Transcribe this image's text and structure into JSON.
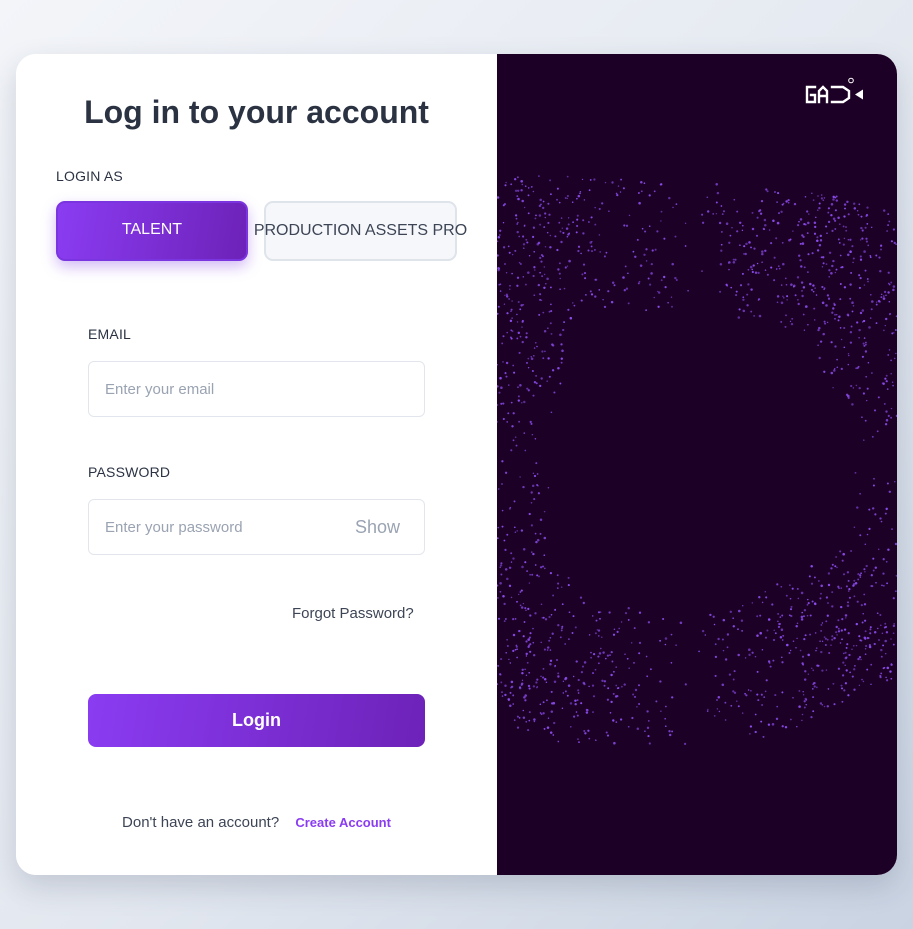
{
  "header": {
    "title": "Log in to your account"
  },
  "login_as": {
    "label": "LOGIN AS",
    "options": [
      {
        "label": "TALENT",
        "selected": true
      },
      {
        "label": "PRODUCTION ASSETS PRO",
        "selected": false
      }
    ]
  },
  "email": {
    "label": "EMAIL",
    "value": "",
    "placeholder": "Enter your email"
  },
  "password": {
    "label": "PASSWORD",
    "value": "",
    "placeholder": "Enter your password",
    "toggle_label": "Show"
  },
  "links": {
    "forgot_password": "Forgot Password?"
  },
  "actions": {
    "login_label": "Login"
  },
  "signup": {
    "prompt": "Don't have an account?",
    "link_label": "Create Account"
  },
  "brand": {
    "logo_icon": "gad-logo-icon",
    "accent": "#8a3cf2",
    "accent_dark": "#6d22b8",
    "panel_background": "#1c0025",
    "particle_color": "#8d4cf0"
  }
}
